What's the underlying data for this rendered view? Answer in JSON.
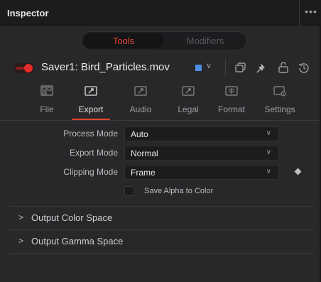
{
  "header": {
    "title": "Inspector",
    "more_glyph": "•••"
  },
  "segmented": {
    "tools_label": "Tools",
    "modifiers_label": "Modifiers"
  },
  "node": {
    "name": "Saver1: Bird_Particles.mov",
    "enabled": true,
    "color_chip": "#4a8fe0",
    "toggle_color": "#e32c2c",
    "icons": [
      "color-chip-chevron-icon",
      "copy-icon",
      "pin-icon",
      "lock-icon",
      "reset-icon"
    ]
  },
  "tabs": [
    {
      "label": "File",
      "icon": "file-icon"
    },
    {
      "label": "Export",
      "icon": "export-icon",
      "active": true
    },
    {
      "label": "Audio",
      "icon": "audio-icon"
    },
    {
      "label": "Legal",
      "icon": "legal-icon"
    },
    {
      "label": "Format",
      "icon": "format-icon"
    },
    {
      "label": "Settings",
      "icon": "settings-icon"
    }
  ],
  "controls": {
    "process_mode": {
      "label": "Process Mode",
      "value": "Auto"
    },
    "export_mode": {
      "label": "Export Mode",
      "value": "Normal"
    },
    "clipping_mode": {
      "label": "Clipping Mode",
      "value": "Frame"
    },
    "save_alpha": {
      "label": "Save Alpha to Color",
      "checked": false
    }
  },
  "sections": [
    {
      "title": "Output Color Space",
      "expanded": false
    },
    {
      "title": "Output Gamma Space",
      "expanded": false
    }
  ],
  "colors": {
    "accent": "#e4442f",
    "panel": "#28282b",
    "header": "#1c1c1e"
  }
}
